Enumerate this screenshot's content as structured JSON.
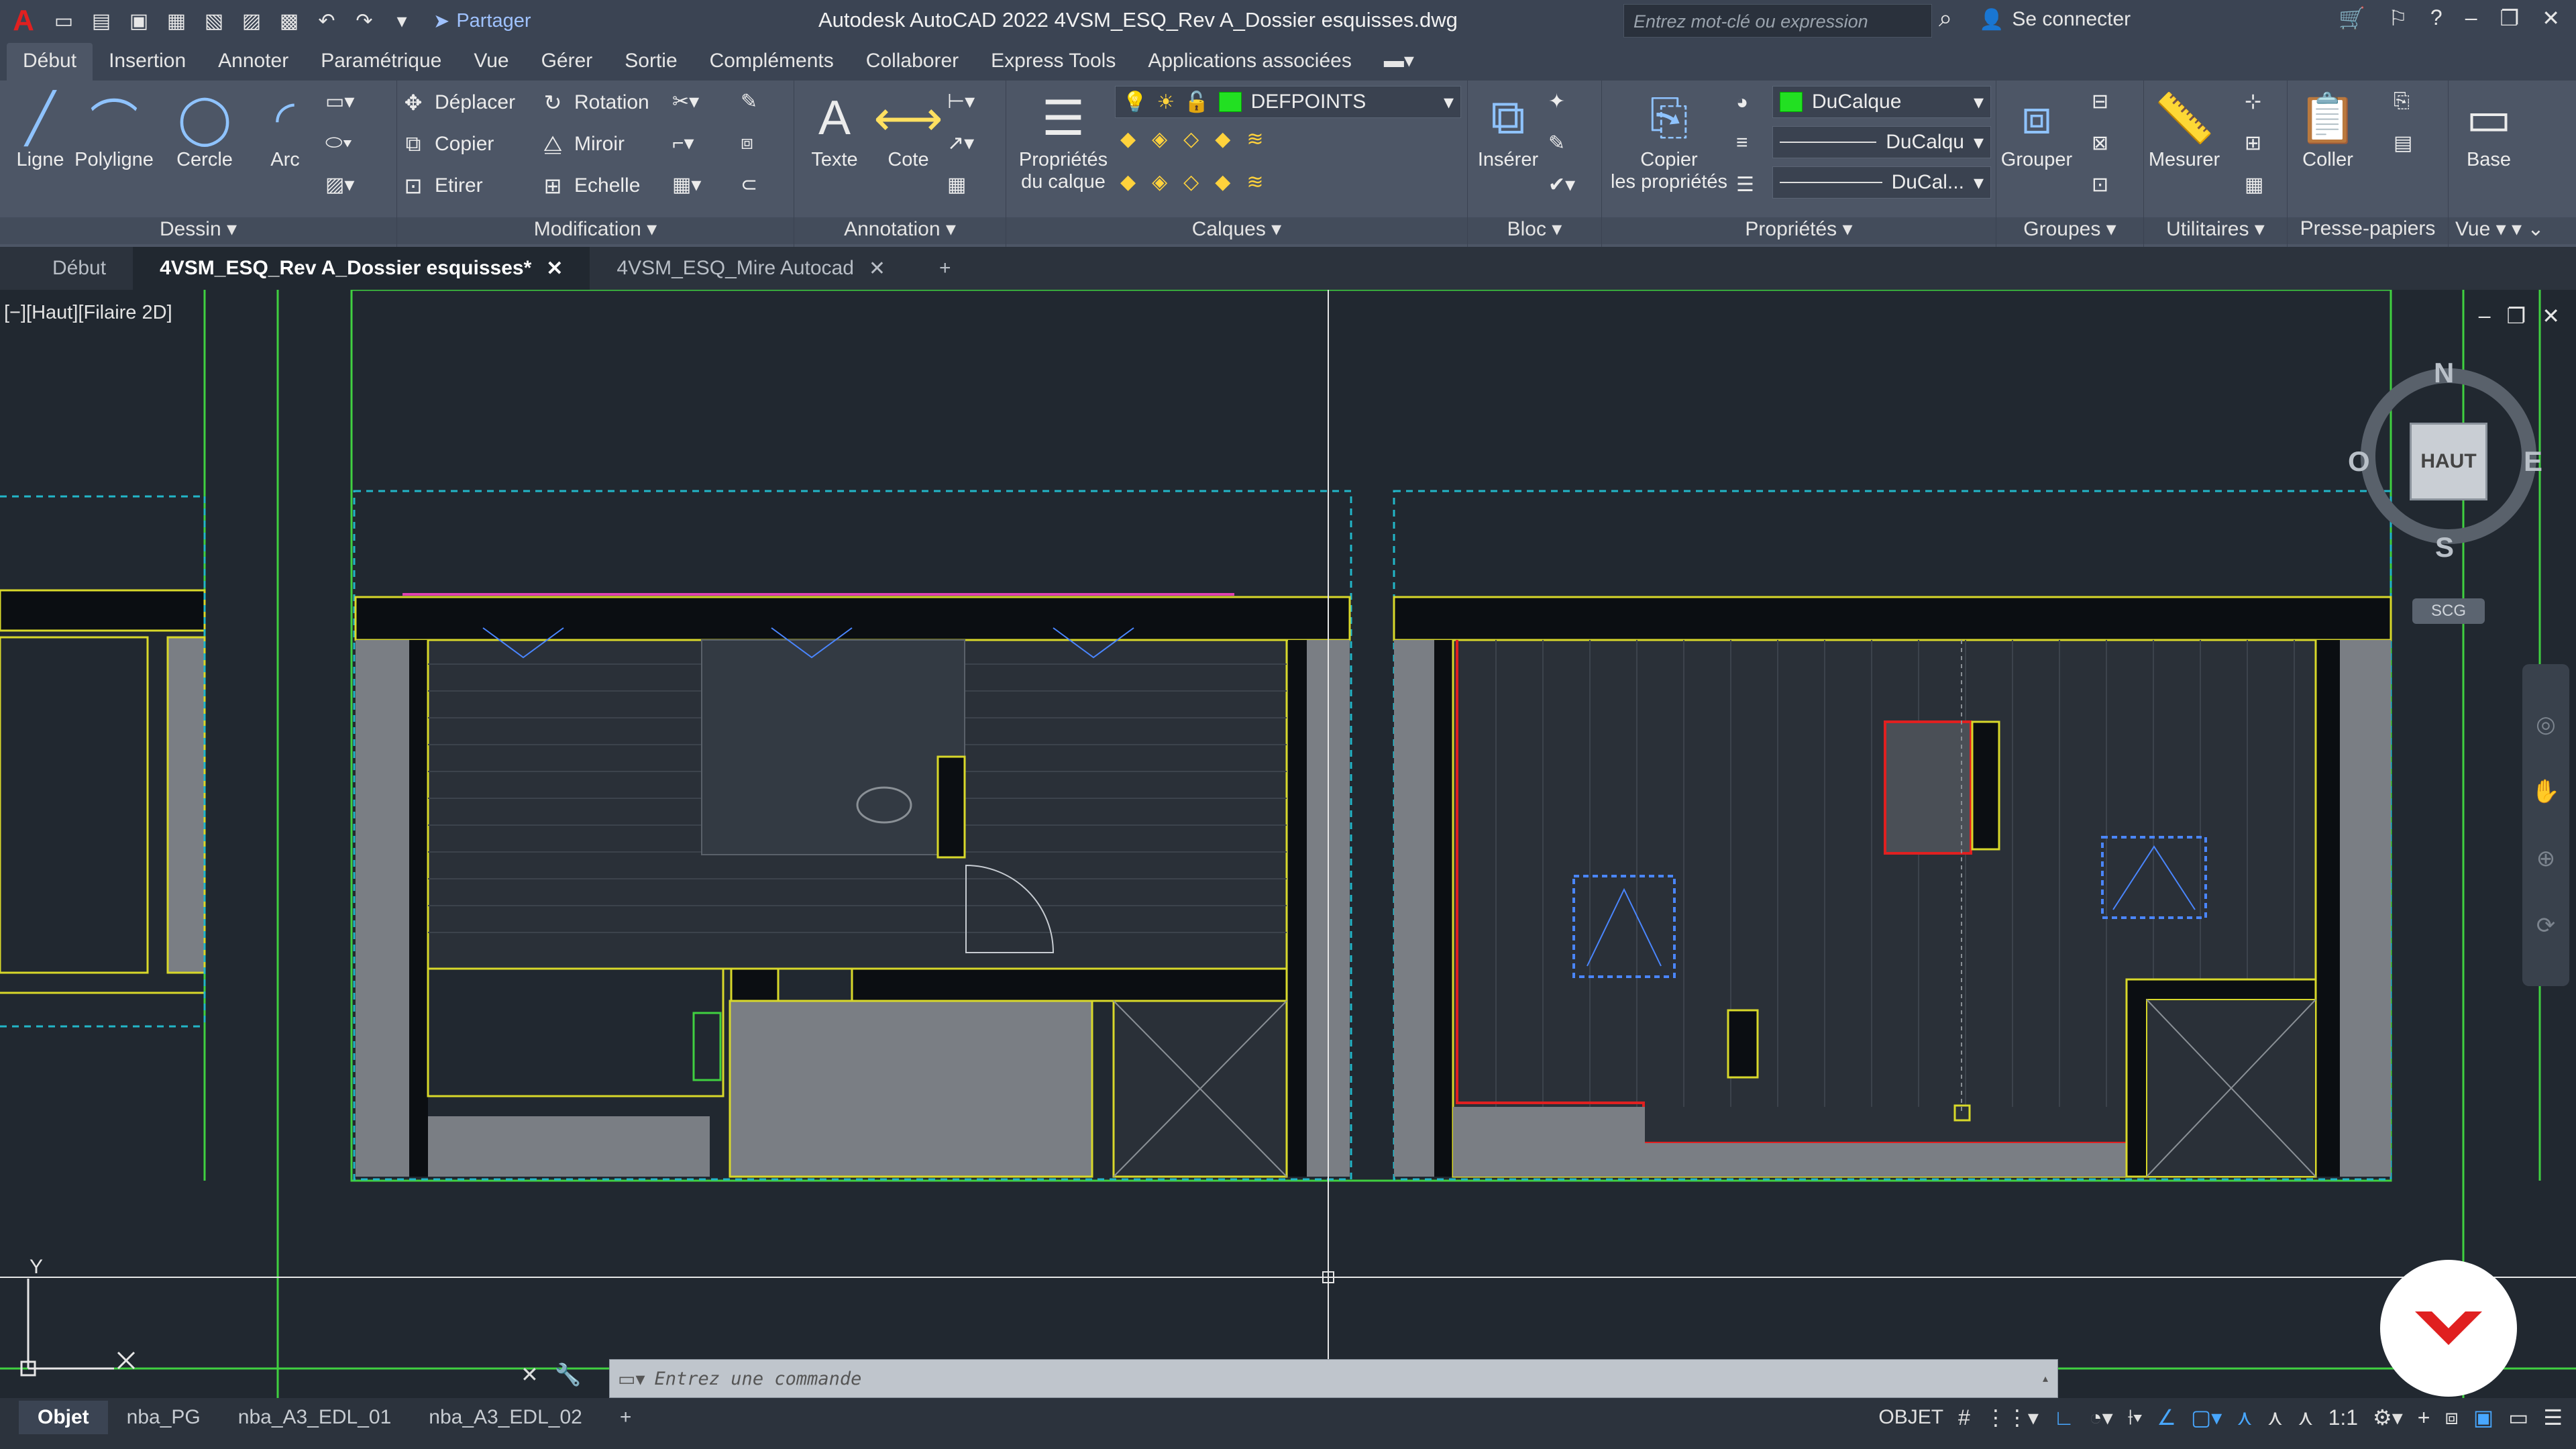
{
  "app": {
    "logo_letter": "A",
    "share_label": "Partager",
    "title": "Autodesk AutoCAD 2022   4VSM_ESQ_Rev A_Dossier esquisses.dwg",
    "search_placeholder": "Entrez mot-clé ou expression",
    "login_label": "Se connecter"
  },
  "ribbon_tabs": [
    "Début",
    "Insertion",
    "Annoter",
    "Paramétrique",
    "Vue",
    "Gérer",
    "Sortie",
    "Compléments",
    "Collaborer",
    "Express Tools",
    "Applications associées"
  ],
  "dessin": {
    "title": "Dessin",
    "ligne": "Ligne",
    "polyligne": "Polyligne",
    "cercle": "Cercle",
    "arc": "Arc"
  },
  "modification": {
    "title": "Modification",
    "deplacer": "Déplacer",
    "rotation": "Rotation",
    "copier": "Copier",
    "miroir": "Miroir",
    "etirer": "Etirer",
    "echelle": "Echelle"
  },
  "annotation": {
    "title": "Annotation",
    "texte": "Texte",
    "cote": "Cote"
  },
  "calques": {
    "title": "Calques",
    "proprietes": "Propriétés",
    "du_calque": "du calque",
    "current_layer": "DEFPOINTS",
    "layer_color": "#22e022"
  },
  "bloc": {
    "title": "Bloc",
    "inserer": "Insérer"
  },
  "proprietes": {
    "title": "Propriétés",
    "copier": "Copier",
    "les_proprietes": "les propriétés",
    "color": "DuCalque",
    "linetype": "DuCalqu",
    "lineweight": "DuCal..."
  },
  "groupes": {
    "title": "Groupes",
    "grouper": "Grouper"
  },
  "utilitaires": {
    "title": "Utilitaires",
    "mesurer": "Mesurer"
  },
  "presse": {
    "title": "Presse-papiers",
    "coller": "Coller"
  },
  "vue": {
    "title": "Vue",
    "base": "Base"
  },
  "doc_tabs": [
    "Début",
    "4VSM_ESQ_Rev A_Dossier esquisses*",
    "4VSM_ESQ_Mire Autocad"
  ],
  "viewport": {
    "label": "[−][Haut][Filaire 2D]",
    "compass": {
      "n": "N",
      "s": "S",
      "e": "E",
      "o": "O",
      "top": "HAUT"
    },
    "scg": "SCG",
    "ucs_y": "Y"
  },
  "command": {
    "placeholder": "Entrez une commande"
  },
  "layout_tabs": [
    "Objet",
    "nba_PG",
    "nba_A3_EDL_01",
    "nba_A3_EDL_02"
  ],
  "status": {
    "mode": "OBJET",
    "scale": "1:1"
  },
  "colors": {
    "accent": "#48a7ff",
    "brand_red": "#e02020"
  }
}
